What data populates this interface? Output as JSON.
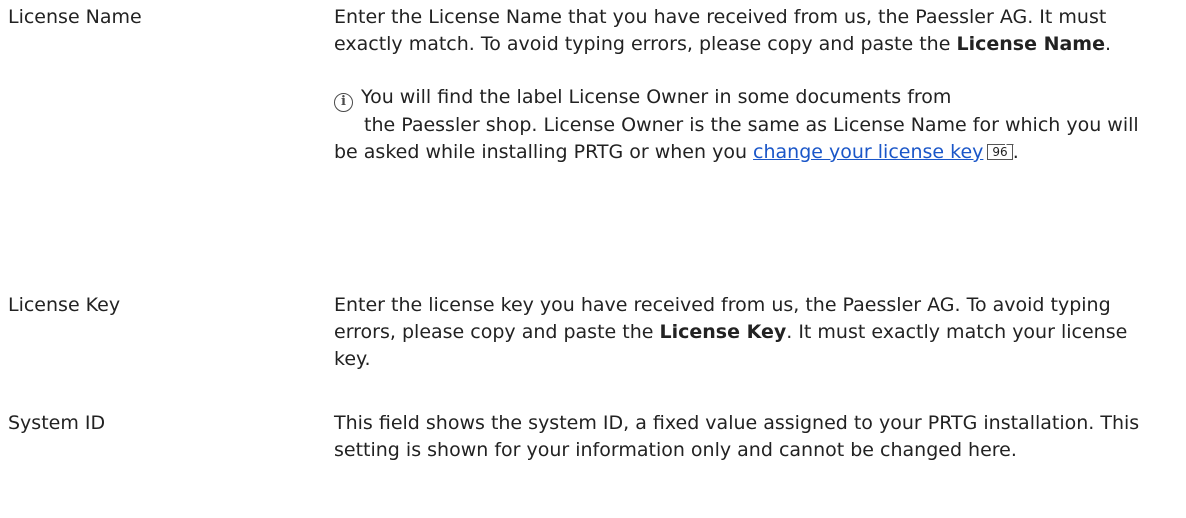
{
  "rows": [
    {
      "label": "License Name",
      "desc_text": "Enter the License Name that you have received from us, the Paessler AG. It must exactly match. To avoid typing errors, please copy and paste the ",
      "desc_bold": "License Name",
      "desc_end": ".",
      "note": {
        "icon": "info-icon",
        "line1": "You will find the label License Owner in some documents from",
        "rest": "the Paessler shop. License Owner is the same as License Name for which you will be asked while installing PRTG or when you",
        "link_text": "change your license key",
        "page_ref": "96",
        "end": "."
      }
    },
    {
      "label": "License Key",
      "desc_text": "Enter the license key you have received from us, the Paessler AG. To avoid typing errors, please copy and paste the ",
      "desc_bold": "License Key",
      "desc_end": ". It must exactly match your license key."
    },
    {
      "label": "System ID",
      "desc_text": "This field shows the system ID, a fixed value assigned to your PRTG installation. This setting is shown for your information only and cannot be changed here."
    }
  ]
}
